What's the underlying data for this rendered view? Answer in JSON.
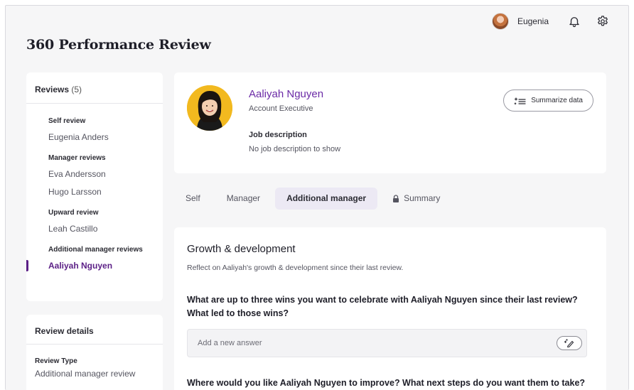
{
  "header": {
    "user_name": "Eugenia",
    "page_title": "360 Performance Review"
  },
  "sidebar": {
    "reviews_title": "Reviews",
    "reviews_count": "(5)",
    "groups": [
      {
        "title": "Self review",
        "items": [
          {
            "label": "Eugenia Anders"
          }
        ]
      },
      {
        "title": "Manager reviews",
        "items": [
          {
            "label": "Eva Andersson"
          },
          {
            "label": "Hugo Larsson"
          }
        ]
      },
      {
        "title": "Upward review",
        "items": [
          {
            "label": "Leah Castillo"
          }
        ]
      },
      {
        "title": "Additional manager reviews",
        "items": [
          {
            "label": "Aaliyah Nguyen"
          }
        ]
      }
    ],
    "details_title": "Review details",
    "details_type_label": "Review Type",
    "details_type_value": "Additional manager review"
  },
  "profile": {
    "name": "Aaliyah Nguyen",
    "role": "Account Executive",
    "job_label": "Job description",
    "job_value": "No job description to show",
    "summarize_label": "Summarize data"
  },
  "tabs": [
    {
      "label": "Self"
    },
    {
      "label": "Manager"
    },
    {
      "label": "Additional manager"
    },
    {
      "label": "Summary"
    }
  ],
  "content": {
    "section_title": "Growth & development",
    "section_subtitle": "Reflect on Aaliyah's growth & development since their last review.",
    "question_1": "What are up to three wins you want to celebrate with Aaliyah Nguyen since their last review? What led to those wins?",
    "answer_placeholder": "Add a new answer",
    "question_2": "Where would you like Aaliyah Nguyen to improve? What next steps do you want them to take?"
  },
  "colors": {
    "accent": "#5b1f86",
    "name_purple": "#6b2aa6",
    "active_tab_bg": "#ece9f4"
  }
}
